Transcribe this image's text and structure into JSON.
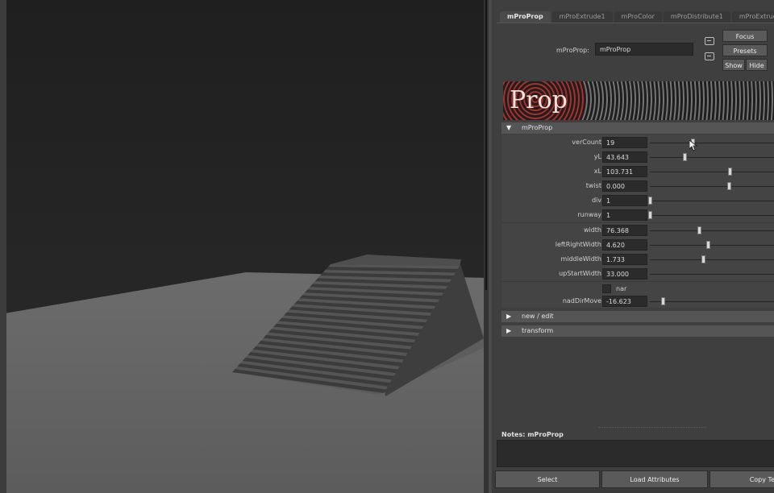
{
  "tabs": [
    {
      "label": "mProProp",
      "active": true
    },
    {
      "label": "mProExtrude1",
      "active": false
    },
    {
      "label": "mProColor",
      "active": false
    },
    {
      "label": "mProDistribute1",
      "active": false
    },
    {
      "label": "mProExtrud",
      "active": false
    }
  ],
  "node": {
    "label": "mProProp:",
    "value": "mProProp"
  },
  "buttons": {
    "focus": "Focus",
    "presets": "Presets",
    "show": "Show",
    "hide": "Hide"
  },
  "banner": {
    "text": "Prop",
    "accent_color": "#b8322c"
  },
  "sections": {
    "main": "mProProp",
    "new_edit": "new / edit",
    "transform": "transform"
  },
  "attributes": [
    {
      "label": "verCount",
      "value": "19",
      "slider": 0.33
    },
    {
      "label": "yL",
      "value": "43.643",
      "slider": 0.27
    },
    {
      "label": "xL",
      "value": "103.731",
      "slider": 0.62
    },
    {
      "label": "twist",
      "value": "0.000",
      "slider": 0.61
    },
    {
      "label": "div",
      "value": "1",
      "slider": 0.0
    },
    {
      "label": "runway",
      "value": "1",
      "slider": 0.0
    },
    {
      "label": "width",
      "value": "76.368",
      "slider": 0.38
    },
    {
      "label": "leftRightWidth",
      "value": "4.620",
      "slider": 0.45
    },
    {
      "label": "middleWidth",
      "value": "1.733",
      "slider": 0.41
    },
    {
      "label": "upStartWidth",
      "value": "33.000",
      "slider": null
    }
  ],
  "checkbox": {
    "label": "nar",
    "checked": false
  },
  "extra_attribute": {
    "label": "nadDirMove",
    "value": "-16.623",
    "slider": 0.1
  },
  "notes": {
    "label": "Notes:  mProProp"
  },
  "bottom_buttons": {
    "select": "Select",
    "load": "Load Attributes",
    "copy": "Copy Te"
  }
}
